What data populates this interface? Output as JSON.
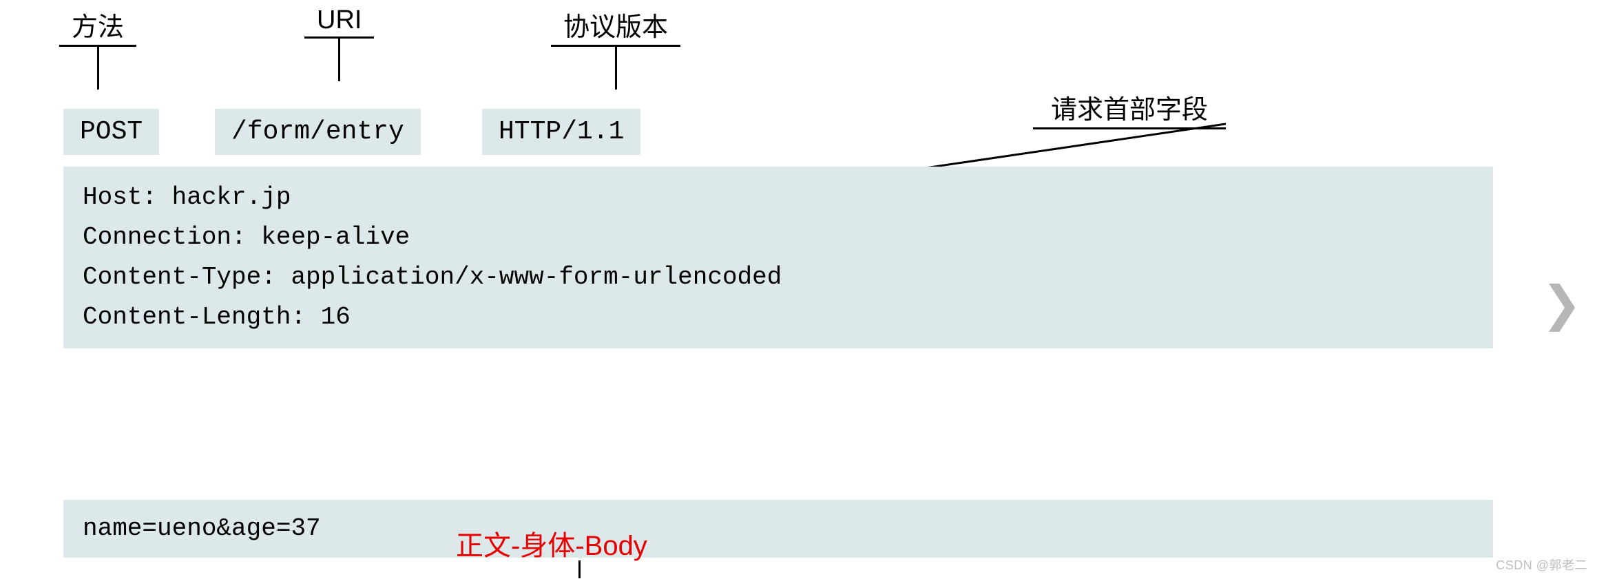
{
  "labels": {
    "method": "方法",
    "uri": "URI",
    "version": "协议版本",
    "headerFields": "请求首部字段",
    "bodyAnnotation": "正文-身体-Body"
  },
  "request": {
    "method": "POST",
    "uri": "/form/entry",
    "version": "HTTP/1.1",
    "headersText": "Host: hackr.jp\nConnection: keep-alive\nContent-Type: application/x-www-form-urlencoded\nContent-Length: 16",
    "body": "name=ueno&age=37"
  },
  "watermark": "CSDN @郭老二"
}
